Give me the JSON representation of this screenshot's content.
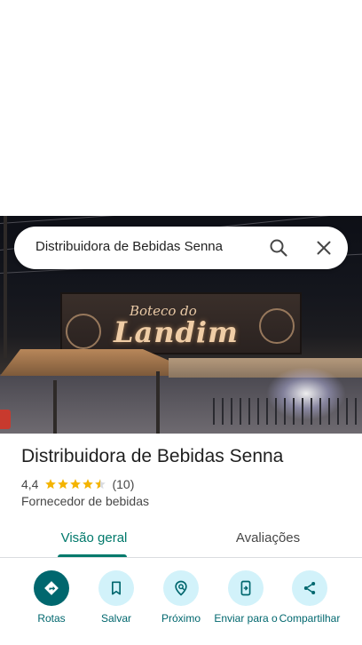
{
  "search": {
    "query": "Distribuidora de Bebidas Senna",
    "search_icon": "search-icon",
    "close_icon": "close-icon"
  },
  "photo": {
    "sign_line_1": "Boteco do",
    "sign_line_2": "Landim"
  },
  "place": {
    "name": "Distribuidora de Bebidas Senna",
    "rating": "4,4",
    "rating_stars": 4.4,
    "review_count": "(10)",
    "category": "Fornecedor de bebidas"
  },
  "tabs": [
    {
      "label": "Visão geral",
      "active": true
    },
    {
      "label": "Avaliações",
      "active": false
    }
  ],
  "actions": [
    {
      "label": "Rotas",
      "icon": "directions-icon"
    },
    {
      "label": "Salvar",
      "icon": "bookmark-icon"
    },
    {
      "label": "Próximo",
      "icon": "nearby-icon"
    },
    {
      "label": "Enviar para o",
      "icon": "send-to-phone-icon"
    },
    {
      "label": "Compartilhar",
      "icon": "share-icon"
    }
  ],
  "colors": {
    "accent": "#00796b",
    "action_primary_bg": "#00676e",
    "action_bg": "#d2f2fa",
    "star": "#f4b400"
  }
}
